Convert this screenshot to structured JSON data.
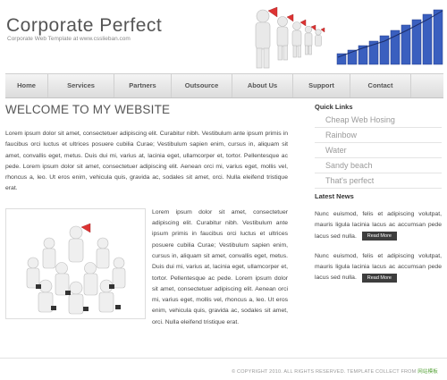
{
  "header": {
    "title": "Corporate Perfect",
    "tagline": "Corporate Web Template at www.csslieban.com"
  },
  "nav": {
    "items": [
      "Home",
      "Services",
      "Partners",
      "Outsource",
      "About Us",
      "Support",
      "Contact"
    ]
  },
  "main": {
    "title": "WELCOME TO MY WEBSITE",
    "para1": "Lorem ipsum dolor sit amet, consectetuer adipiscing elit. Curabitur nibh. Vestibulum ante ipsum primis in faucibus orci luctus et ultrices posuere cubilia Curae; Vestibulum sapien enim, cursus in, aliquam sit amet, convallis eget, metus. Duis dui mi, varius at, lacinia eget, ullamcorper et, tortor. Pellentesque ac pede. Lorem ipsum dolor sit amet, consectetuer adipiscing elit. Aenean orci mi, varius eget, mollis vel, rhoncus a, leo. Ut eros enim, vehicula quis, gravida ac, sodales sit amet, orci. Nulla eleifend tristique erat.",
    "para2": "Lorem ipsum dolor sit amet, consectetuer adipiscing elit. Curabitur nibh. Vestibulum ante ipsum primis in faucibus orci luctus et ultrices posuere cubilia Curae; Vestibulum sapien enim, cursus in, aliquam sit amet, convallis eget, metus. Duis dui mi, varius at, lacinia eget, ullamcorper et, tortor. Pellentesque ac pede. Lorem ipsum dolor sit amet, consectetuer adipiscing elit. Aenean orci mi, varius eget, mollis vel, rhoncus a, leo. Ut eros enim, vehicula quis, gravida ac, sodales sit amet, orci. Nulla eleifend tristique erat."
  },
  "sidebar": {
    "quick_links_title": "Quick Links",
    "quick_links": [
      "Cheap Web Hosing",
      "Rainbow",
      "Water",
      "Sandy beach",
      "That's perfect"
    ],
    "news_title": "Latest News",
    "news": [
      {
        "text": "Nunc euismod, felis et adipiscing volutpat, mauris ligula lacinia lacus ac accumsan pede lacus sed nulla.",
        "button": "Read More"
      },
      {
        "text": "Nunc euismod, felis et adipiscing volutpat, mauris ligula lacinia lacus ac accumsan pede lacus sed nulla.",
        "button": "Read More"
      }
    ]
  },
  "footer": {
    "text": "© COPYRIGHT 2010. ALL RIGHTS RESERVED. TEMPLATE COLLECT FROM",
    "link": "网站模板"
  },
  "colors": {
    "chart_blue": "#3a5fbf",
    "footer_link": "#59a43c",
    "button_bg": "#3d3d3d"
  }
}
